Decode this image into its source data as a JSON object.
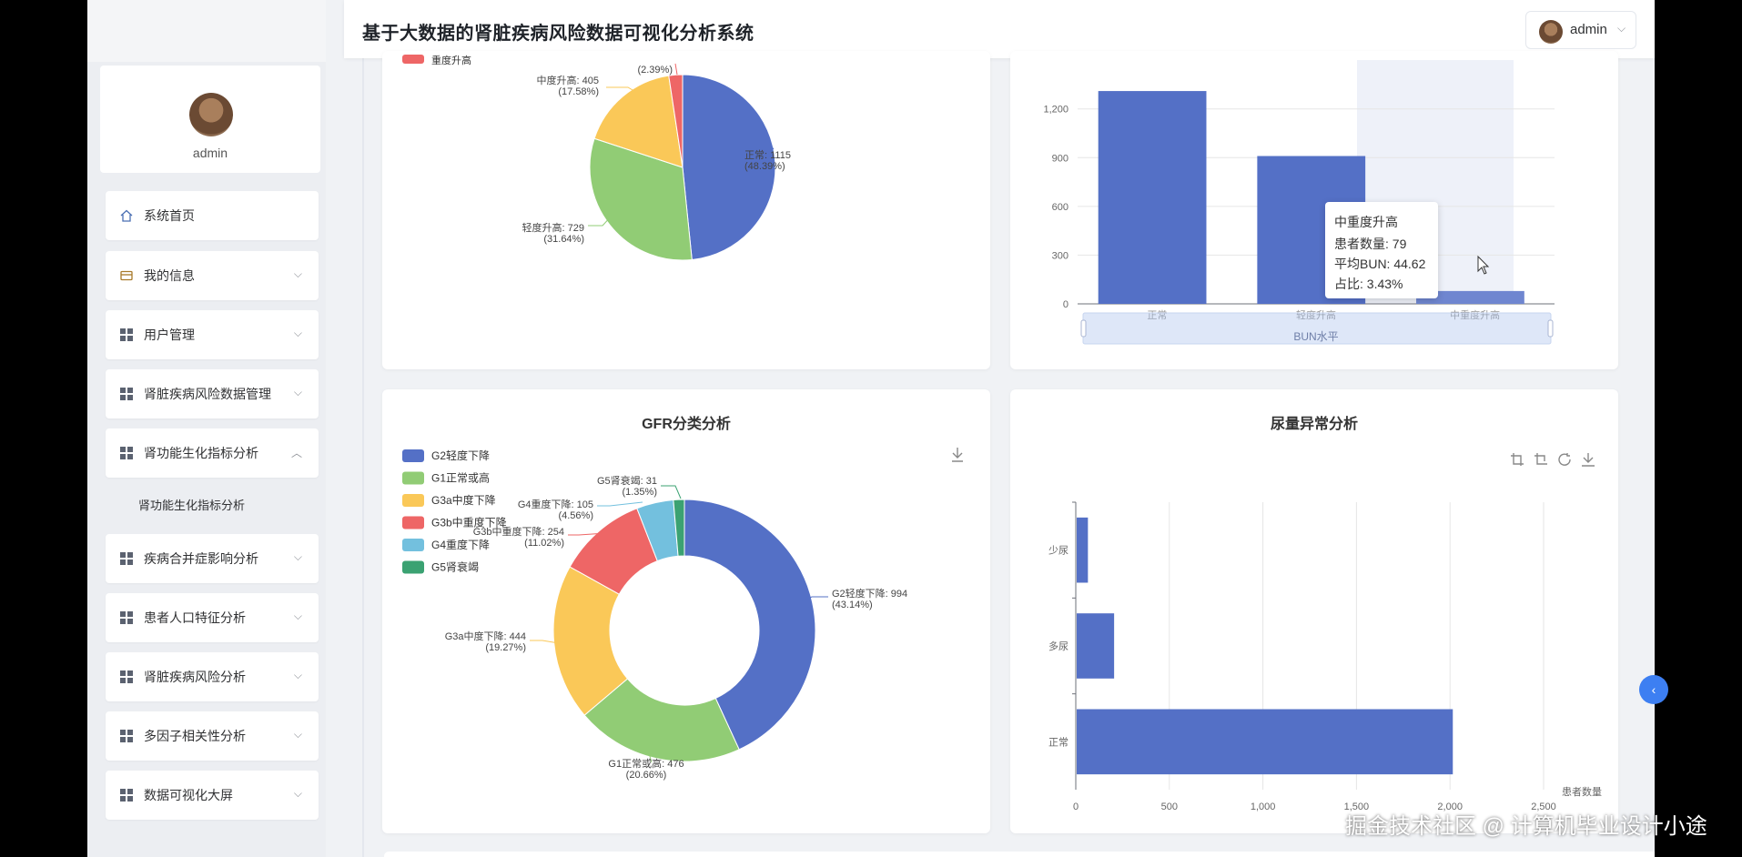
{
  "header": {
    "title": "基于大数据的肾脏疾病风险数据可视化分析系统",
    "user": "admin"
  },
  "profile": {
    "name": "admin"
  },
  "menu": [
    {
      "label": "系统首页",
      "icon": "home-icon",
      "arrow": ""
    },
    {
      "label": "我的信息",
      "icon": "id-card-icon",
      "arrow": "⌵"
    },
    {
      "label": "用户管理",
      "icon": "grid-icon",
      "arrow": "⌵"
    },
    {
      "label": "肾脏疾病风险数据管理",
      "icon": "grid-icon",
      "arrow": "⌵"
    },
    {
      "label": "肾功能生化指标分析",
      "icon": "grid-icon",
      "arrow": "︿"
    },
    {
      "label": "疾病合并症影响分析",
      "icon": "grid-icon",
      "arrow": "⌵"
    },
    {
      "label": "患者人口特征分析",
      "icon": "grid-icon",
      "arrow": "⌵"
    },
    {
      "label": "肾脏疾病风险分析",
      "icon": "grid-icon",
      "arrow": "⌵"
    },
    {
      "label": "多因子相关性分析",
      "icon": "grid-icon",
      "arrow": "⌵"
    },
    {
      "label": "数据可视化大屏",
      "icon": "grid-icon",
      "arrow": "⌵"
    }
  ],
  "submenu": {
    "label": "肾功能生化指标分析"
  },
  "colors": {
    "blue": "#5470c6",
    "green": "#91cc75",
    "yellow": "#fac858",
    "red": "#ee6666",
    "lightblue": "#73c0de",
    "teal": "#3ba272",
    "accent": "#3d7ff2"
  },
  "tooltip": {
    "title": "中重度升高",
    "count": "患者数量: 79",
    "avg": "平均BUN: 44.62",
    "ratio": "占比: 3.43%"
  },
  "watermark": "掘金技术社区 @ 计算机毕业设计小途",
  "chart_data": [
    {
      "type": "pie",
      "legend_partial": [
        "重度升高"
      ],
      "slices": [
        {
          "name": "正常",
          "value": 1115,
          "pct": "48.39%",
          "label": "正常: 1115",
          "pct_label": "(48.39%)",
          "color": "#5470c6"
        },
        {
          "name": "轻度升高",
          "value": 729,
          "pct": "31.64%",
          "label": "轻度升高: 729",
          "pct_label": "(31.64%)",
          "color": "#91cc75"
        },
        {
          "name": "中度升高",
          "value": 405,
          "pct": "17.58%",
          "label": "中度升高: 405",
          "pct_label": "(17.58%)",
          "color": "#fac858"
        },
        {
          "name": "重度升高",
          "value": 55,
          "pct": "2.39%",
          "label": "",
          "pct_label": "(2.39%)",
          "color": "#ee6666"
        }
      ]
    },
    {
      "type": "bar",
      "categories": [
        "正常",
        "轻度升高",
        "中重度升高"
      ],
      "values": [
        1310,
        910,
        79
      ],
      "xlabel": "BUN水平",
      "yticks": [
        "0",
        "300",
        "600",
        "900",
        "1,200"
      ],
      "ylim": [
        0,
        1400
      ]
    },
    {
      "type": "pie",
      "title": "GFR分类分析",
      "legend": [
        "G2轻度下降",
        "G1正常或高",
        "G3a中度下降",
        "G3b中重度下降",
        "G4重度下降",
        "G5肾衰竭"
      ],
      "slices": [
        {
          "name": "G2轻度下降",
          "value": 994,
          "label": "G2轻度下降: 994",
          "pct_label": "(43.14%)",
          "color": "#5470c6"
        },
        {
          "name": "G1正常或高",
          "value": 476,
          "label": "G1正常或高: 476",
          "pct_label": "(20.66%)",
          "color": "#91cc75"
        },
        {
          "name": "G3a中度下降",
          "value": 444,
          "label": "G3a中度下降: 444",
          "pct_label": "(19.27%)",
          "color": "#fac858"
        },
        {
          "name": "G3b中重度下降",
          "value": 254,
          "label": "G3b中重度下降: 254",
          "pct_label": "(11.02%)",
          "color": "#ee6666"
        },
        {
          "name": "G4重度下降",
          "value": 105,
          "label": "G4重度下降: 105",
          "pct_label": "(4.56%)",
          "color": "#73c0de"
        },
        {
          "name": "G5肾衰竭",
          "value": 31,
          "label": "G5肾衰竭: 31",
          "pct_label": "(1.35%)",
          "color": "#3ba272"
        }
      ]
    },
    {
      "type": "bar",
      "orientation": "horizontal",
      "title": "尿量异常分析",
      "categories": [
        "少尿",
        "多尿",
        "正常"
      ],
      "values": [
        60,
        200,
        2010
      ],
      "xticks": [
        "0",
        "500",
        "1,000",
        "1,500",
        "2,000",
        "2,500"
      ],
      "xlim": [
        0,
        2500
      ],
      "xlabel": "患者数量"
    }
  ]
}
